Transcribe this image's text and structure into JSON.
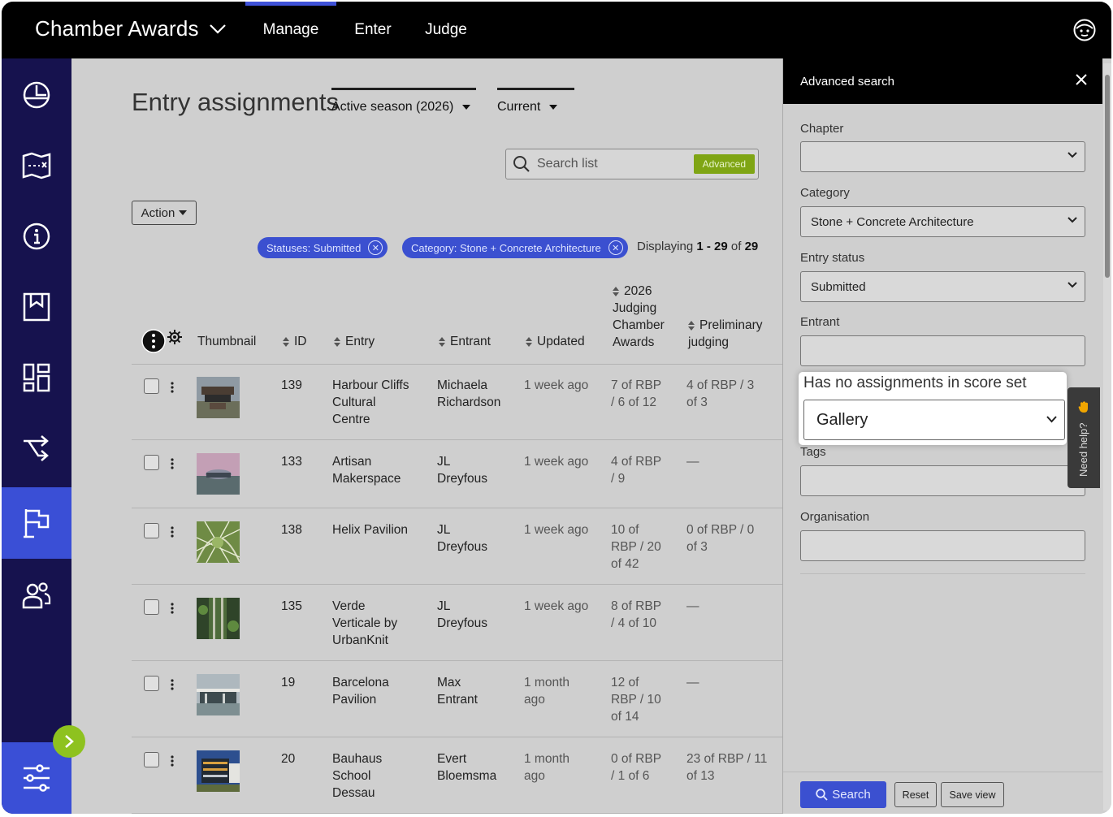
{
  "app": {
    "title": "Chamber Awards"
  },
  "topnav": [
    {
      "label": "Manage",
      "active": true
    },
    {
      "label": "Enter",
      "active": false
    },
    {
      "label": "Judge",
      "active": false
    }
  ],
  "sidebar": {
    "items": [
      {
        "icon": "dashboard-gauge-icon"
      },
      {
        "icon": "map-icon"
      },
      {
        "icon": "info-icon"
      },
      {
        "icon": "bookmark-icon"
      },
      {
        "icon": "grid-icon"
      },
      {
        "icon": "shuffle-icon"
      },
      {
        "icon": "flag-icon",
        "active": true
      },
      {
        "icon": "users-icon"
      }
    ],
    "bottom_icon": "settings-sliders-icon",
    "expand_icon": "chevron-right-icon"
  },
  "page": {
    "title": "Entry assignments",
    "season_filter": "Active season (2026)",
    "view_filter": "Current",
    "search_placeholder": "Search list",
    "advanced_label": "Advanced",
    "action_label": "Action",
    "chips": [
      "Statuses: Submitted",
      "Category: Stone + Concrete Architecture"
    ],
    "displaying": {
      "prefix": "Displaying ",
      "range": "1 - 29",
      "of": " of ",
      "total": "29"
    }
  },
  "table": {
    "columns": {
      "thumbnail": "Thumbnail",
      "id": "ID",
      "entry": "Entry",
      "entrant": "Entrant",
      "updated": "Updated",
      "judging": [
        "2026",
        "Judging",
        "Chamber",
        "Awards"
      ],
      "preliminary": [
        "Preliminary",
        "judging"
      ]
    },
    "rows": [
      {
        "id": "139",
        "entry": [
          "Harbour Cliffs",
          "Cultural",
          "Centre"
        ],
        "entrant": [
          "Michaela",
          "Richardson"
        ],
        "updated": [
          "1 week ago"
        ],
        "judging": [
          "7 of RBP",
          "/ 6 of 12"
        ],
        "preliminary": [
          "4 of RBP / 3",
          "of 3"
        ],
        "thumb": "t1"
      },
      {
        "id": "133",
        "entry": [
          "Artisan",
          "Makerspace"
        ],
        "entrant": [
          "JL",
          "Dreyfous"
        ],
        "updated": [
          "1 week ago"
        ],
        "judging": [
          "4 of RBP",
          "/ 9"
        ],
        "preliminary": [
          "—"
        ],
        "thumb": "t2"
      },
      {
        "id": "138",
        "entry": [
          "Helix Pavilion"
        ],
        "entrant": [
          "JL",
          "Dreyfous"
        ],
        "updated": [
          "1 week ago"
        ],
        "judging": [
          "10 of",
          "RBP / 20",
          "of 42"
        ],
        "preliminary": [
          "0 of RBP / 0",
          "of 3"
        ],
        "thumb": "t3"
      },
      {
        "id": "135",
        "entry": [
          "Verde",
          "Verticale by",
          "UrbanKnit"
        ],
        "entrant": [
          "JL",
          "Dreyfous"
        ],
        "updated": [
          "1 week ago"
        ],
        "judging": [
          "8 of RBP",
          "/ 4 of 10"
        ],
        "preliminary": [
          "—"
        ],
        "thumb": "t4"
      },
      {
        "id": "19",
        "entry": [
          "Barcelona",
          "Pavilion"
        ],
        "entrant": [
          "Max",
          "Entrant"
        ],
        "updated": [
          "1 month",
          "ago"
        ],
        "judging": [
          "12 of",
          "RBP / 10",
          "of 14"
        ],
        "preliminary": [
          "—"
        ],
        "thumb": "t5"
      },
      {
        "id": "20",
        "entry": [
          "Bauhaus",
          "School",
          "Dessau"
        ],
        "entrant": [
          "Evert",
          "Bloemsma"
        ],
        "updated": [
          "1 month",
          "ago"
        ],
        "judging": [
          "0 of RBP",
          "/ 1 of 6"
        ],
        "preliminary": [
          "23 of RBP / 11",
          "of 13"
        ],
        "thumb": "t6"
      }
    ]
  },
  "panel": {
    "title": "Advanced search",
    "fields": {
      "chapter": {
        "label": "Chapter",
        "value": ""
      },
      "category": {
        "label": "Category",
        "value": "Stone + Concrete Architecture"
      },
      "status": {
        "label": "Entry status",
        "value": "Submitted"
      },
      "entrant": {
        "label": "Entrant",
        "value": ""
      },
      "score_set": {
        "label": "Has no assignments in score set",
        "value": "Gallery"
      },
      "tags": {
        "label": "Tags",
        "value": ""
      },
      "organisation": {
        "label": "Organisation",
        "value": ""
      }
    },
    "buttons": {
      "search": "Search",
      "reset": "Reset",
      "save_view": "Save view"
    }
  },
  "help": {
    "label": "Need help?"
  },
  "colors": {
    "accent": "#3b50d0",
    "sidebar": "#16124e",
    "advanced": "#7fa514",
    "expand": "#8ec21f"
  }
}
